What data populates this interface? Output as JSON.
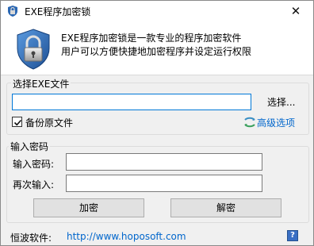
{
  "window": {
    "title": "EXE程序加密锁",
    "close_glyph": "✕"
  },
  "header": {
    "line1": "EXE程序加密锁是一款专业的程序加密软件",
    "line2": "用户可以方便快捷地加密程序并设定运行权限"
  },
  "file_group": {
    "label": "选择EXE文件",
    "input_value": "",
    "browse_label": "选择...",
    "backup_label": "备份原文件",
    "backup_checked": true,
    "advanced_label": "高级选项"
  },
  "password_group": {
    "label": "输入密码",
    "password_label": "输入密码:",
    "confirm_label": "再次输入:",
    "password_value": "",
    "confirm_value": ""
  },
  "buttons": {
    "encrypt": "加密",
    "decrypt": "解密"
  },
  "footer": {
    "label": "恒波软件:",
    "link": "http://www.hoposoft.com",
    "help_glyph": "?"
  },
  "icons": {
    "app": "lock-app-icon",
    "header": "shield-lock-icon",
    "advanced": "advanced-options-icon",
    "help": "help-icon"
  },
  "colors": {
    "link": "#0066cc",
    "focus": "#0078d7",
    "shield": "#2a67b3"
  }
}
